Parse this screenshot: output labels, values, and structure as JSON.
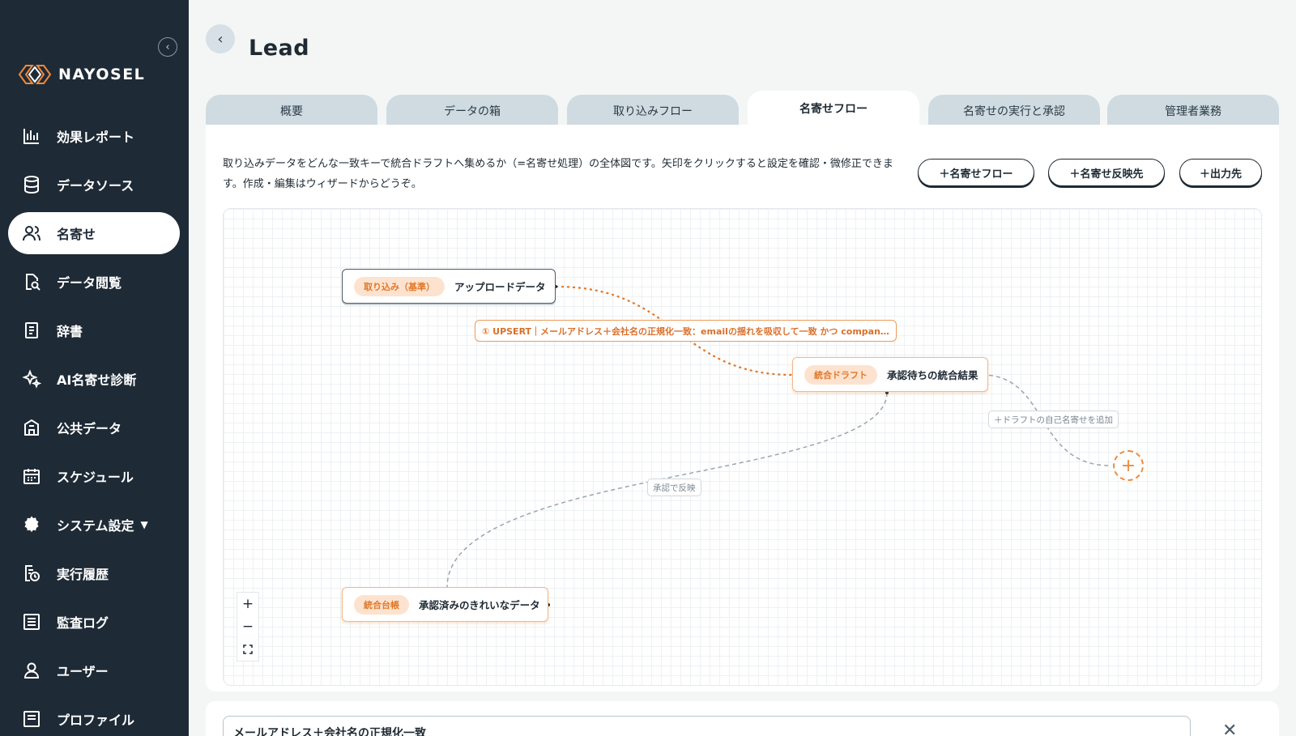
{
  "sidebar": {
    "collapse_icon": "chevron-left-icon",
    "logo_text": "NAYOSEL",
    "items": [
      {
        "label": "効果レポート",
        "icon": "bar-chart-icon"
      },
      {
        "label": "データソース",
        "icon": "database-icon"
      },
      {
        "label": "名寄せ",
        "icon": "users-icon",
        "active": true
      },
      {
        "label": "データ閲覧",
        "icon": "document-search-icon"
      },
      {
        "label": "辞書",
        "icon": "book-icon"
      },
      {
        "label": "AI名寄せ診断",
        "icon": "sparkles-icon"
      },
      {
        "label": "公共データ",
        "icon": "building-icon"
      },
      {
        "label": "スケジュール",
        "icon": "calendar-icon"
      },
      {
        "label": "システム設定",
        "icon": "gear-icon",
        "caret": "▼"
      },
      {
        "label": "実行履歴",
        "icon": "history-icon"
      },
      {
        "label": "監査ログ",
        "icon": "log-icon"
      },
      {
        "label": "ユーザー",
        "icon": "user-icon"
      },
      {
        "label": "プロファイル",
        "icon": "profile-icon"
      }
    ]
  },
  "header": {
    "back_icon": "chevron-left-icon",
    "title": "Lead"
  },
  "tabs": [
    {
      "label": "概要"
    },
    {
      "label": "データの箱"
    },
    {
      "label": "取り込みフロー"
    },
    {
      "label": "名寄せフロー",
      "active": true
    },
    {
      "label": "名寄せの実行と承認"
    },
    {
      "label": "管理者業務"
    }
  ],
  "panel": {
    "description": "取り込みデータをどんな一致キーで統合ドラフトへ集めるか（=名寄せ処理）の全体図です。矢印をクリックすると設定を確認・微修正できます。作成・編集はウィザードからどうぞ。",
    "buttons": {
      "add_flow": "＋名寄せフロー",
      "add_reflect": "＋名寄せ反映先",
      "add_output": "＋出力先"
    }
  },
  "flow": {
    "source_node": {
      "chip": "取り込み（基準）",
      "label": "アップロードデータ"
    },
    "edge_rule_label": "① UPSERT｜メールアドレス＋会社名の正規化一致：emailの揺れを吸収して一致 かつ compan…",
    "draft_node": {
      "chip": "統合ドラフト",
      "label": "承認待ちの統合結果"
    },
    "self_merge_label": "＋ドラフトの自己名寄せを追加",
    "reflect_label": "承認で反映",
    "ledger_node": {
      "chip": "統合台帳",
      "label": "承認済みのきれいなデータ"
    },
    "add_icon": "plus-circle-icon",
    "zoom": {
      "in": "+",
      "out": "−",
      "fit_icon": "fit-view-icon"
    }
  },
  "colors": {
    "sidebar_bg": "#1e2a36",
    "accent_orange": "#ee8a3c",
    "chip_bg": "#fde3cf",
    "tab_bg": "#cfdbe1"
  },
  "bottom": {
    "field_value": "メールアドレス＋会社名の正規化一致",
    "close_icon": "close-icon"
  }
}
